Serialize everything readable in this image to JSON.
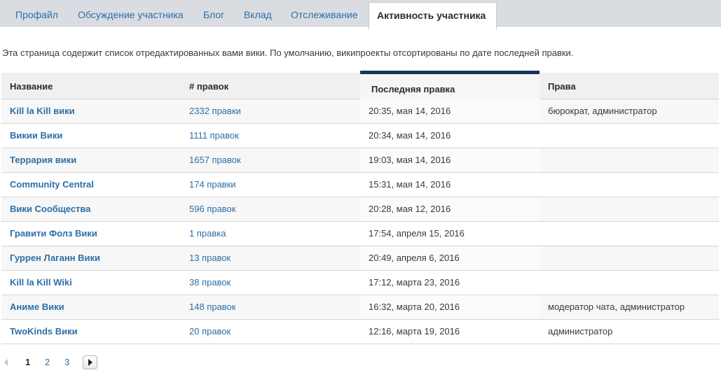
{
  "tabs": [
    {
      "label": "Профайл",
      "active": false
    },
    {
      "label": "Обсуждение участника",
      "active": false
    },
    {
      "label": "Блог",
      "active": false
    },
    {
      "label": "Вклад",
      "active": false
    },
    {
      "label": "Отслеживание",
      "active": false
    },
    {
      "label": "Активность участника",
      "active": true
    }
  ],
  "intro": "Эта страница содержит список отредактированных вами вики. По умолчанию, википроекты отсортированы по дате последней правки.",
  "table": {
    "headers": {
      "name": "Название",
      "edits": "# правок",
      "last_edit": "Последняя правка",
      "rights": "Права"
    },
    "sorted_by": "last_edit",
    "rows": [
      {
        "name": "Kill la Kill вики",
        "edits": "2332 правки",
        "last_edit": "20:35, мая 14, 2016",
        "rights": "бюрократ, администратор"
      },
      {
        "name": "Викии Вики",
        "edits": "1111 правок",
        "last_edit": "20:34, мая 14, 2016",
        "rights": ""
      },
      {
        "name": "Террария вики",
        "edits": "1657 правок",
        "last_edit": "19:03, мая 14, 2016",
        "rights": ""
      },
      {
        "name": "Community Central",
        "edits": "174 правки",
        "last_edit": "15:31, мая 14, 2016",
        "rights": ""
      },
      {
        "name": "Вики Сообщества",
        "edits": "596 правок",
        "last_edit": "20:28, мая 12, 2016",
        "rights": ""
      },
      {
        "name": "Гравити Фолз Вики",
        "edits": "1 правка",
        "last_edit": "17:54, апреля 15, 2016",
        "rights": ""
      },
      {
        "name": "Гуррен Лаганн Вики",
        "edits": "13 правок",
        "last_edit": "20:49, апреля 6, 2016",
        "rights": ""
      },
      {
        "name": "Kill la Kill Wiki",
        "edits": "38 правок",
        "last_edit": "17:12, марта 23, 2016",
        "rights": ""
      },
      {
        "name": "Аниме Вики",
        "edits": "148 правок",
        "last_edit": "16:32, марта 20, 2016",
        "rights": "модератор чата, администратор"
      },
      {
        "name": "TwoKinds Вики",
        "edits": "20 правок",
        "last_edit": "12:16, марта 19, 2016",
        "rights": "администратор"
      }
    ]
  },
  "pagination": {
    "pages": [
      "1",
      "2",
      "3"
    ],
    "current": "1",
    "prev_icon": "chevron-left-icon",
    "next_icon": "chevron-right-icon"
  },
  "colors": {
    "link": "#2e6ea6",
    "tabbar_bg": "#d9dde2",
    "sort_indicator": "#19355e",
    "header_bg": "#f0f0f0"
  }
}
